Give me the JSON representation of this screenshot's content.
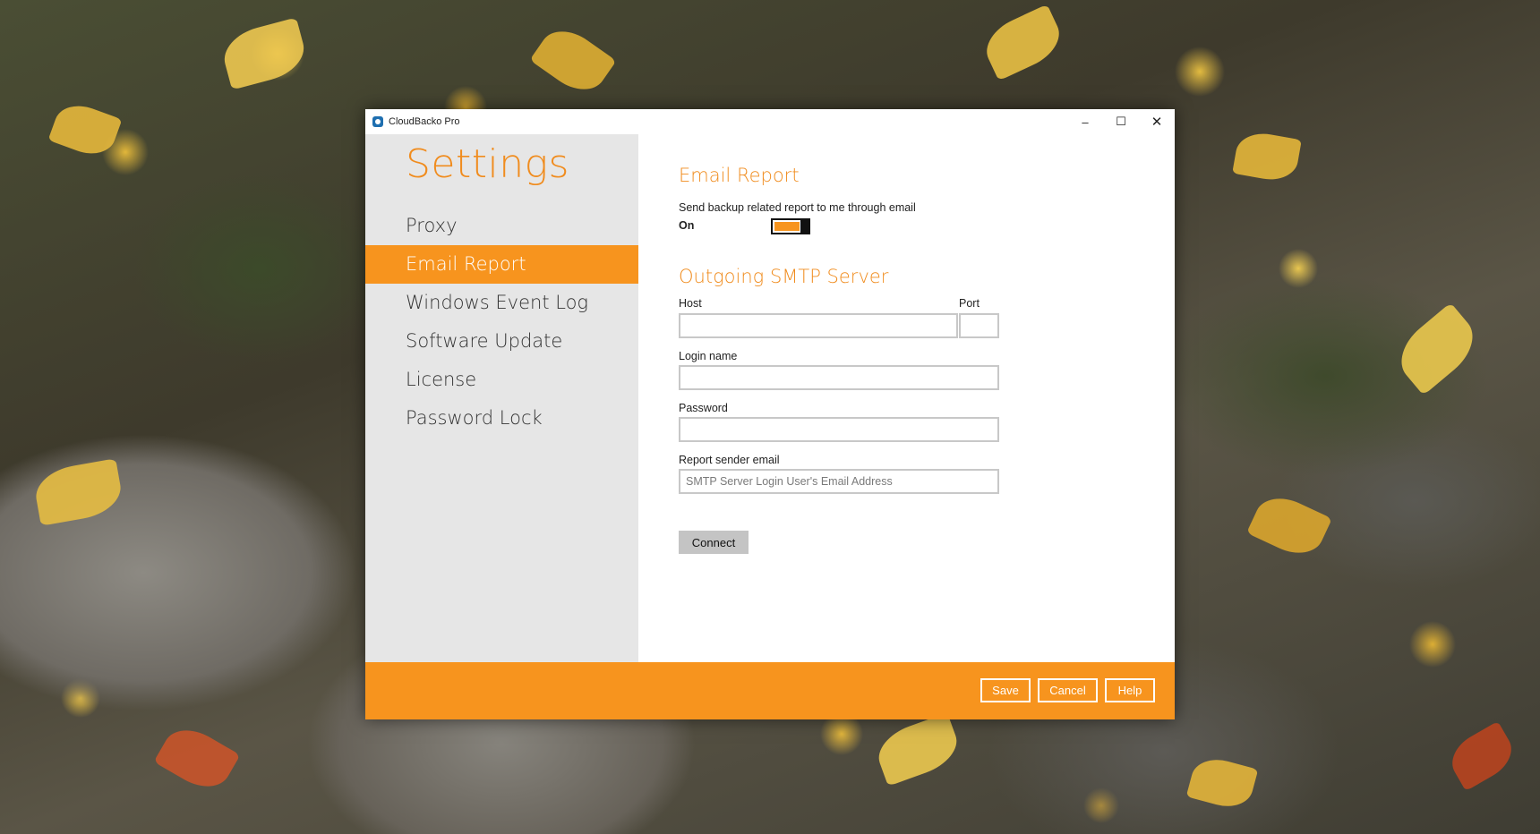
{
  "window": {
    "title": "CloudBacko Pro",
    "minimize_glyph": "–",
    "maximize_glyph": "☐",
    "close_glyph": "✕"
  },
  "sidebar": {
    "title": "Settings",
    "items": [
      {
        "label": "Proxy",
        "active": false
      },
      {
        "label": "Email Report",
        "active": true
      },
      {
        "label": "Windows Event Log",
        "active": false
      },
      {
        "label": "Software Update",
        "active": false
      },
      {
        "label": "License",
        "active": false
      },
      {
        "label": "Password Lock",
        "active": false
      }
    ]
  },
  "email_report": {
    "title": "Email Report",
    "description": "Send backup related report to me through email",
    "toggle_label": "On",
    "enabled": true
  },
  "smtp": {
    "title": "Outgoing SMTP Server",
    "host_label": "Host",
    "host_value": "",
    "port_label": "Port",
    "port_value": "",
    "login_label": "Login name",
    "login_value": "",
    "password_label": "Password",
    "password_value": "",
    "sender_label": "Report sender email",
    "sender_value": "",
    "sender_placeholder": "SMTP Server Login User's Email Address",
    "connect_label": "Connect"
  },
  "footer": {
    "save_label": "Save",
    "cancel_label": "Cancel",
    "help_label": "Help"
  },
  "colors": {
    "accent": "#f7941e",
    "sidebar_bg": "#e6e6e6"
  }
}
